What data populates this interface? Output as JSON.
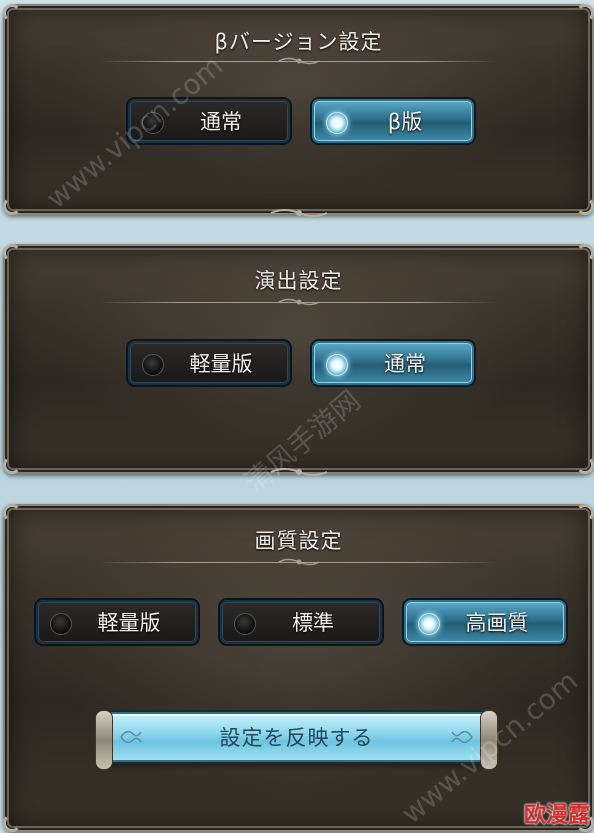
{
  "beta_panel": {
    "title": "βバージョン設定",
    "options": [
      {
        "label": "通常",
        "selected": false
      },
      {
        "label": "β版",
        "selected": true
      }
    ]
  },
  "effect_panel": {
    "title": "演出設定",
    "options": [
      {
        "label": "軽量版",
        "selected": false
      },
      {
        "label": "通常",
        "selected": true
      }
    ]
  },
  "quality_panel": {
    "title": "画質設定",
    "options": [
      {
        "label": "軽量版",
        "selected": false
      },
      {
        "label": "標準",
        "selected": false
      },
      {
        "label": "高画質",
        "selected": true
      }
    ],
    "apply_label": "設定を反映する"
  },
  "watermarks": {
    "site_top": "www.vipcn.com",
    "site_middle": "清风手游网",
    "site_bottom": "www.vipcn.com",
    "corner_badge": "欧漫露"
  },
  "colors": {
    "selected_option": "#3e8aa8",
    "unselected_option": "#1a1917",
    "apply_button": "#8fd8ee",
    "panel_background": "#3b342b",
    "page_background": "#c9dde4"
  }
}
